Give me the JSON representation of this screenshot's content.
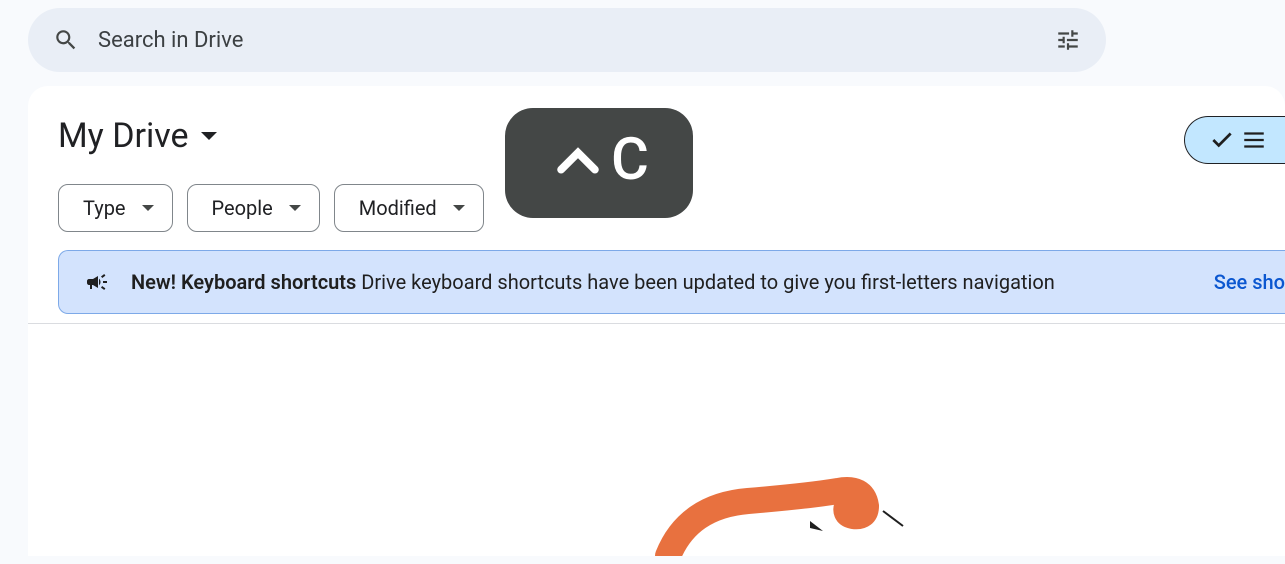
{
  "search": {
    "placeholder": "Search in Drive"
  },
  "page": {
    "title": "My Drive"
  },
  "filters": {
    "type": "Type",
    "people": "People",
    "modified": "Modified"
  },
  "banner": {
    "title": "New! Keyboard shortcuts",
    "message": "Drive keyboard shortcuts have been updated to give you first-letters navigation",
    "link": "See sho"
  },
  "overlay": {
    "shortcut": "^C"
  }
}
